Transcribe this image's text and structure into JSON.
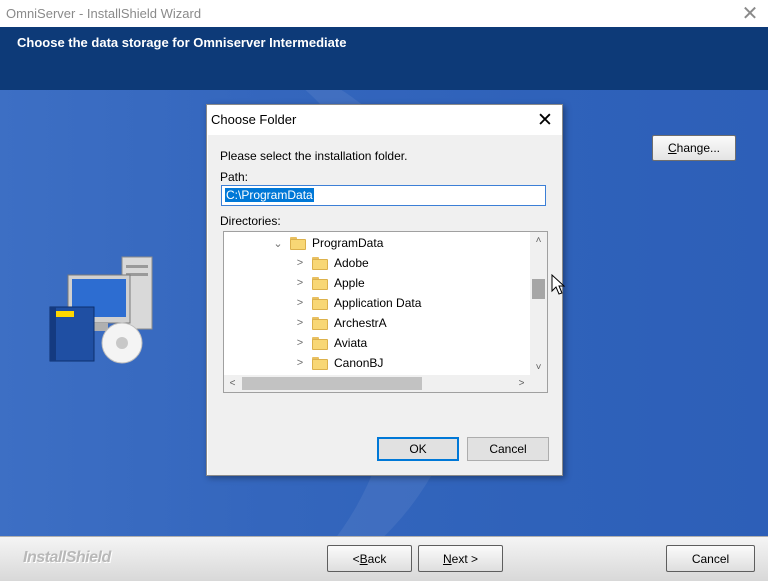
{
  "window": {
    "title": "OmniServer - InstallShield Wizard",
    "heading": "Choose the data storage for Omniserver Intermediate"
  },
  "main": {
    "change_label_u": "C",
    "change_label_rest": "hange..."
  },
  "footer": {
    "brand": "InstallShield",
    "back_prefix": "< ",
    "back_u": "B",
    "back_rest": "ack",
    "next_u": "N",
    "next_rest": "ext >",
    "cancel_label": "Cancel"
  },
  "dialog": {
    "title": "Choose Folder",
    "prompt": "Please select the installation folder.",
    "path_label": "Path:",
    "path_value": "C:\\ProgramData",
    "directories_label": "Directories:",
    "tree": {
      "root": "ProgramData",
      "children": [
        "Adobe",
        "Apple",
        "Application Data",
        "ArchestrA",
        "Aviata",
        "CanonBJ"
      ]
    },
    "ok_label": "OK",
    "cancel_label": "Cancel"
  },
  "colors": {
    "header_band": "#0d3a78",
    "body_blue": "#3466bd",
    "selection": "#0078d7",
    "folder": "#f8d775"
  },
  "icons": {
    "close": "close-icon",
    "folder": "folder-icon",
    "expand": "chevron-right-icon",
    "collapse": "chevron-down-icon"
  }
}
